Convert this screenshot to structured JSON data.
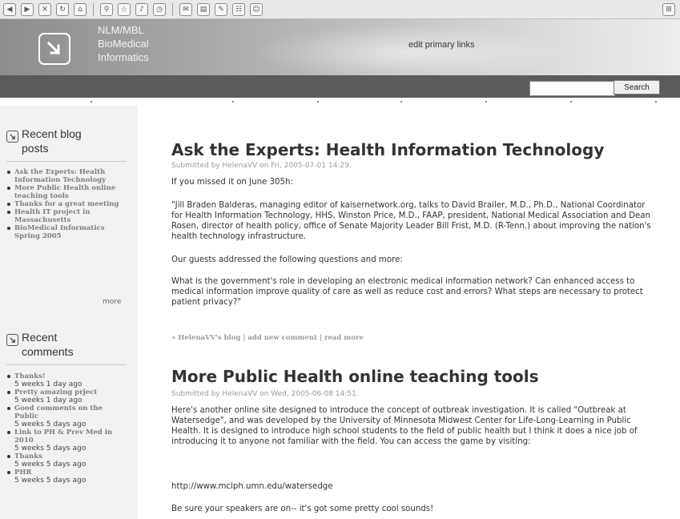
{
  "toolbar": {
    "icons": [
      "back-icon",
      "forward-icon",
      "stop-icon",
      "refresh-icon",
      "home-icon",
      "search-icon",
      "favorites-icon",
      "media-icon",
      "history-icon",
      "mail-icon",
      "print-icon",
      "edit-icon",
      "discuss-icon",
      "messenger-icon"
    ]
  },
  "header": {
    "site_name_line1": "NLM/MBL",
    "site_name_line2": "BioMedical",
    "site_name_line3": "Informatics",
    "primary_links": "edit primary links"
  },
  "search": {
    "button_label": "Search",
    "value": ""
  },
  "sidebar": {
    "recent_posts": {
      "title": "Recent blog posts",
      "items": [
        "Ask the Experts: Health Information Technology",
        "More Public Health online teaching tools",
        "Thanks for a great meeting",
        "Health IT project in Massachusetts",
        "BioMedical Informatics Spring 2005"
      ],
      "more_label": "more"
    },
    "recent_comments": {
      "title": "Recent comments",
      "items": [
        {
          "title": "Thanks!",
          "ago": "5 weeks 1 day ago"
        },
        {
          "title": "Pretty amazing prject",
          "ago": "5 weeks 1 day ago"
        },
        {
          "title": "Good comments on the Public",
          "ago": "5 weeks 5 days ago"
        },
        {
          "title": "Link to PH & Prev Med in 2010",
          "ago": "5 weeks 5 days ago"
        },
        {
          "title": "Thanks",
          "ago": "5 weeks 5 days ago"
        },
        {
          "title": "PHR",
          "ago": "5 weeks 5 days ago"
        }
      ]
    }
  },
  "posts": [
    {
      "title": "Ask the Experts: Health Information Technology",
      "submitted": "Submitted by HelenaVV on Fri, 2005-07-01 14:29.",
      "paragraphs": [
        "If you missed it on June 305h:",
        "\"Jill Braden Balderas, managing editor of kaisernetwork.org, talks to David Brailer, M.D., Ph.D., National Coordinator for Health Information Technology, HHS, Winston Price, M.D., FAAP, president, National Medical Association and Dean Rosen, director of health policy, office of Senate Majority Leader Bill Frist, M.D. (R-Tenn.) about improving the nation's health technology infrastructure.",
        "Our guests addressed the following questions and more:",
        "What is the government's role in developing an electronic medical information network? Can enhanced access to medical information improve quality of care as well as reduce cost and errors? What steps are necessary to protect patient privacy?\""
      ],
      "links": {
        "blog": "» HelenaVV's blog",
        "sep": "|",
        "comment": "add new comment",
        "read_more": "read more"
      }
    },
    {
      "title": "More Public Health online teaching tools",
      "submitted": "Submitted by HelenaVV on Wed, 2005-06-08 14:51.",
      "paragraphs": [
        "Here's another online site designed to introduce the concept of outbreak investigation. It is called \"Outbreak at Watersedge\", and was developed by the University of Minnesota Midwest Center for Life-Long-Learning in Public Health. It is designed to introduce high school students to the field of public health but I think it does a nice job of introducing it to anyone not familiar with the field. You can access the game by visiting:",
        "http://www.mclph.umn.edu/watersedge",
        "Be sure your speakers are on-- it's got some pretty cool sounds!"
      ]
    }
  ]
}
